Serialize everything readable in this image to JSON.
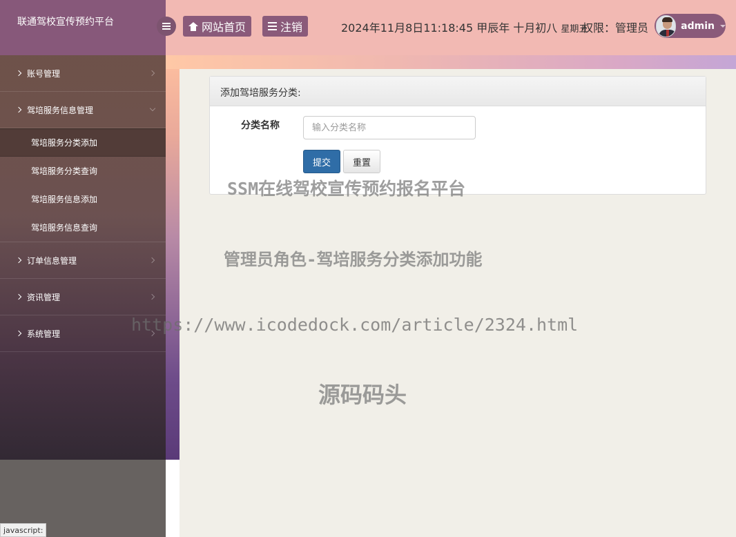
{
  "brand": {
    "title": "联通驾校宣传预约平台"
  },
  "header": {
    "home_label": "网站首页",
    "logout_label": "注销",
    "datetime": "2024年11月8日11:18:45 甲辰年 十月初八",
    "weekday": "星期五",
    "role_text": "权限：管理员",
    "username": "admin"
  },
  "sidebar": {
    "items": [
      {
        "label": "账号管理"
      },
      {
        "label": "驾培服务信息管理",
        "children": [
          {
            "label": "驾培服务分类添加"
          },
          {
            "label": "驾培服务分类查询"
          },
          {
            "label": "驾培服务信息添加"
          },
          {
            "label": "驾培服务信息查询"
          }
        ]
      },
      {
        "label": "订单信息管理"
      },
      {
        "label": "资讯管理"
      },
      {
        "label": "系统管理"
      }
    ]
  },
  "panel": {
    "title": "添加驾培服务分类:",
    "field_label": "分类名称",
    "field_placeholder": "输入分类名称",
    "field_value": "",
    "submit_label": "提交",
    "reset_label": "重置"
  },
  "watermarks": {
    "line1": "SSM在线驾校宣传预约报名平台",
    "line2": "管理员角色-驾培服务分类添加功能",
    "line3": "https://www.icodedock.com/article/2324.html",
    "line4": "源码码头"
  },
  "statusbar": {
    "text": "javascript:"
  }
}
